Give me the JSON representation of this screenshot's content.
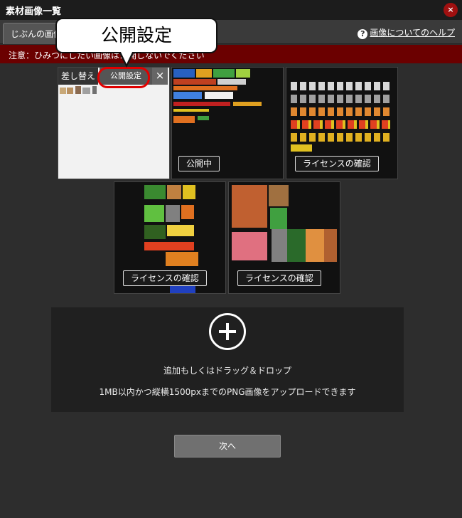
{
  "window": {
    "title": "素材画像一覧",
    "close_label": "×"
  },
  "tabs": [
    {
      "label": "じぶんの画像"
    }
  ],
  "help": {
    "icon": "?",
    "label": "画像についてのヘルプ"
  },
  "notice": {
    "text": "注意：ひみつにしたい画像は公開しないでください"
  },
  "callout": {
    "text": "公開設定"
  },
  "cards": [
    {
      "swap_label": "差し替え",
      "public_label": "公開設定",
      "delete_label": "×"
    },
    {
      "badge": "公開中"
    },
    {
      "badge": "ライセンスの確認"
    },
    {
      "badge": "ライセンスの確認"
    },
    {
      "badge": "ライセンスの確認"
    }
  ],
  "dropzone": {
    "icon": "plus-circle-icon",
    "line1": "追加もしくはドラッグ＆ドロップ",
    "line2": "1MB以内かつ縦横1500pxまでのPNG画像をアップロードできます"
  },
  "next_button": {
    "label": "次へ"
  },
  "colors": {
    "notice_bg": "#6b0000",
    "highlight_ring": "#e00000",
    "close_bg": "#a01010"
  }
}
